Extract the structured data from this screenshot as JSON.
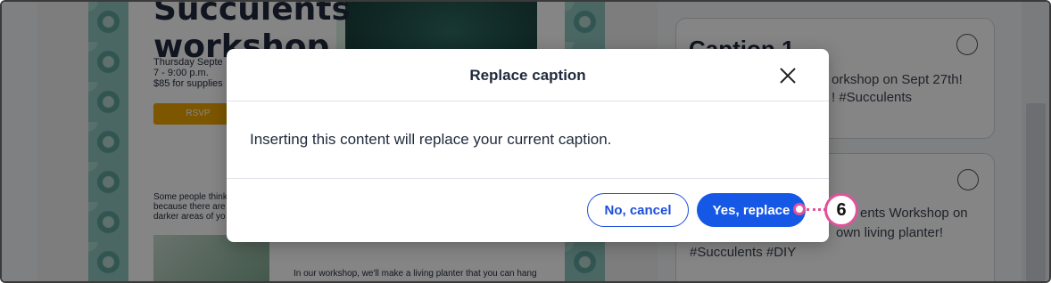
{
  "email": {
    "title_line1": "Succulents",
    "title_line2": "workshop.",
    "date": "Thursday Septe",
    "time": "7 - 9:00 p.m.",
    "price": "$85 for supplies",
    "rsvp": "RSVP",
    "body1_l1": "Some people think",
    "body1_l2": "because there are",
    "body1_l3": "darker areas of yo",
    "body2": "In our workshop, we'll make a living planter that you can hang"
  },
  "captions": {
    "card1_title": "Caption 1",
    "card1_line1": "orkshop on Sept 27th!",
    "card1_line2": "! #Succulents",
    "card2_line1": "ents Workshop on",
    "card2_line2": "own living planter!",
    "card2_line3": "#Succulents #DIY"
  },
  "modal": {
    "title": "Replace caption",
    "message": "Inserting this content will replace your current caption.",
    "cancel_label": "No, cancel",
    "confirm_label": "Yes, replace"
  },
  "callout": {
    "number": "6",
    "color": "#e0529a"
  },
  "icons": {
    "close": "close-icon"
  }
}
